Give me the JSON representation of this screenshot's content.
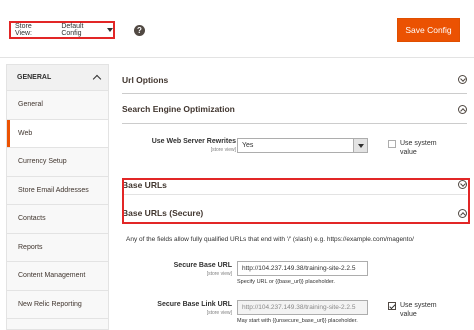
{
  "header": {
    "scope_label": "Store View:",
    "scope_value": "Default Config",
    "help_glyph": "?",
    "save_label": "Save Config"
  },
  "sidebar": {
    "group": "GENERAL",
    "items": [
      {
        "label": "General"
      },
      {
        "label": "Web",
        "active": true
      },
      {
        "label": "Currency Setup"
      },
      {
        "label": "Store Email Addresses"
      },
      {
        "label": "Contacts"
      },
      {
        "label": "Reports"
      },
      {
        "label": "Content Management"
      },
      {
        "label": "New Relic Reporting"
      }
    ]
  },
  "sections": {
    "url_options": "Url Options",
    "seo": "Search Engine Optimization",
    "base_urls": "Base URLs",
    "base_urls_secure": "Base URLs (Secure)"
  },
  "seo_fields": {
    "rewrites_label": "Use Web Server Rewrites",
    "rewrites_scope": "[store view]",
    "rewrites_value": "Yes",
    "use_system_label": "Use system value",
    "use_system_checked": false
  },
  "secure": {
    "info": "Any of the fields allow fully qualified URLs that end with '/' (slash) e.g. https://example.com/magento/",
    "base_url_label": "Secure Base URL",
    "base_url_scope": "[store view]",
    "base_url_value": "http://104.237.149.38/training-site-2.2.5",
    "base_url_hint": "Specify URL or {{base_url}} placeholder.",
    "link_url_label": "Secure Base Link URL",
    "link_url_scope": "[store view]",
    "link_url_value": "http://104.237.149.38/training-site-2.2.5",
    "link_url_hint": "May start with {{unsecure_base_url}} placeholder.",
    "use_system_label": "Use system value",
    "use_system_checked": true
  },
  "colors": {
    "accent": "#eb5202",
    "highlight": "#e22626"
  }
}
